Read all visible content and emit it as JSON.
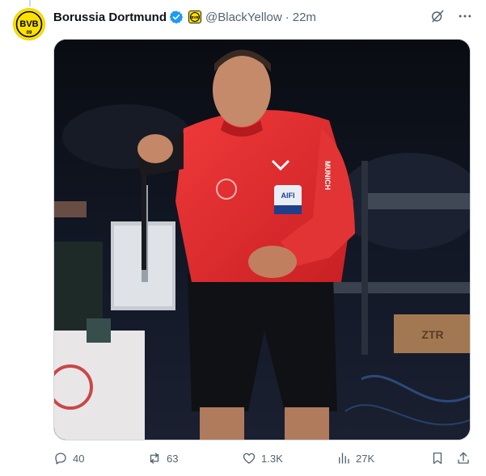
{
  "post": {
    "author_name": "Borussia Dortmund",
    "handle": "@BlackYellow",
    "separator": "·",
    "time": "22m",
    "avatar_text": "BVB",
    "avatar_sub": "09"
  },
  "media": {
    "shirt_text": "MUNICH",
    "badge_text": "AIFI",
    "box_text": "ZTR"
  },
  "actions": {
    "replies": "40",
    "reposts": "63",
    "likes": "1.3K",
    "views": "27K"
  },
  "icons": {
    "verified": "verified-badge-icon",
    "grok": "grok-icon",
    "more": "more-icon",
    "reply": "reply-icon",
    "repost": "repost-icon",
    "like": "like-icon",
    "views": "views-icon",
    "bookmark": "bookmark-icon",
    "share": "share-icon"
  },
  "colors": {
    "accent": "#1d9bf0",
    "muted": "#536471",
    "brand_yellow": "#fde100"
  }
}
